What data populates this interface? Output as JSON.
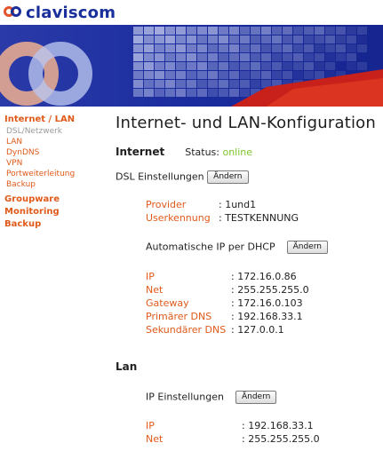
{
  "brand": {
    "name": "claviscom"
  },
  "sidebar": {
    "groups": [
      {
        "label": "Internet / LAN",
        "items": [
          "DSL/Netzwerk",
          "LAN",
          "DynDNS",
          "VPN",
          "Portweiterleitung",
          "Backup"
        ]
      },
      {
        "label": "Groupware",
        "items": []
      },
      {
        "label": "Monitoring",
        "items": []
      },
      {
        "label": "Backup",
        "items": []
      }
    ],
    "active_item": "DSL/Netzwerk"
  },
  "page": {
    "title": "Internet- und LAN-Konfiguration"
  },
  "internet": {
    "title": "Internet",
    "status_label": "Status:",
    "status_value": "online",
    "dsl": {
      "title": "DSL Einstellungen",
      "button": "Ändern",
      "rows": [
        {
          "label": "Provider",
          "value": "1und1"
        },
        {
          "label": "Userkennung",
          "value": "TESTKENNUNG"
        }
      ]
    },
    "dhcp": {
      "title": "Automatische IP per DHCP",
      "button": "Ändern",
      "rows": [
        {
          "label": "IP",
          "value": "172.16.0.86"
        },
        {
          "label": "Net",
          "value": "255.255.255.0"
        },
        {
          "label": "Gateway",
          "value": "172.16.0.103"
        },
        {
          "label": "Primärer DNS",
          "value": "192.168.33.1"
        },
        {
          "label": "Sekundärer DNS",
          "value": "127.0.0.1"
        }
      ]
    }
  },
  "lan": {
    "title": "Lan",
    "ip": {
      "title": "IP Einstellungen",
      "button": "Ändern",
      "rows": [
        {
          "label": "IP",
          "value": "192.168.33.1"
        },
        {
          "label": "Net",
          "value": "255.255.255.0"
        }
      ]
    }
  },
  "colors": {
    "accent": "#e05a1a",
    "brand_blue": "#1a2f9c",
    "status_online": "#7cc42b"
  }
}
